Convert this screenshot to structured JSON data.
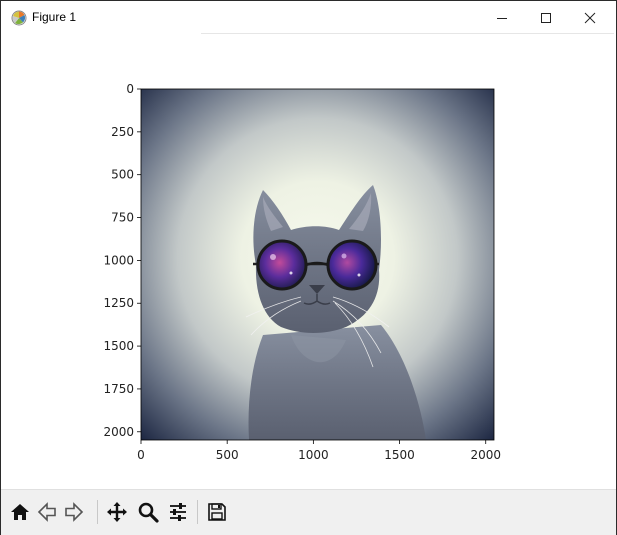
{
  "window": {
    "title": "Figure 1"
  },
  "toolbar": {
    "buttons": [
      {
        "name": "home",
        "icon": "home-icon"
      },
      {
        "name": "back",
        "icon": "arrow-left-icon"
      },
      {
        "name": "forward",
        "icon": "arrow-right-icon"
      },
      {
        "name": "pan",
        "icon": "move-icon"
      },
      {
        "name": "zoom",
        "icon": "magnifier-icon"
      },
      {
        "name": "configure-subplots",
        "icon": "sliders-icon"
      },
      {
        "name": "save",
        "icon": "floppy-disk-icon"
      }
    ]
  },
  "chart_data": {
    "type": "image",
    "x_ticks": [
      "0",
      "500",
      "1000",
      "1500",
      "2000"
    ],
    "y_ticks": [
      "0",
      "250",
      "500",
      "750",
      "1000",
      "1250",
      "1500",
      "1750",
      "2000"
    ],
    "xlim": [
      0,
      2048
    ],
    "ylim": [
      2048,
      0
    ],
    "image_content": "gray cat wearing round purple galaxy-lens sunglasses on a light vignette background",
    "colors": {
      "vignette_center": "#f4f8ea",
      "vignette_edge": "#1f2a44",
      "cat_fur": "#6a7080",
      "lens": "#5a2a90"
    }
  }
}
